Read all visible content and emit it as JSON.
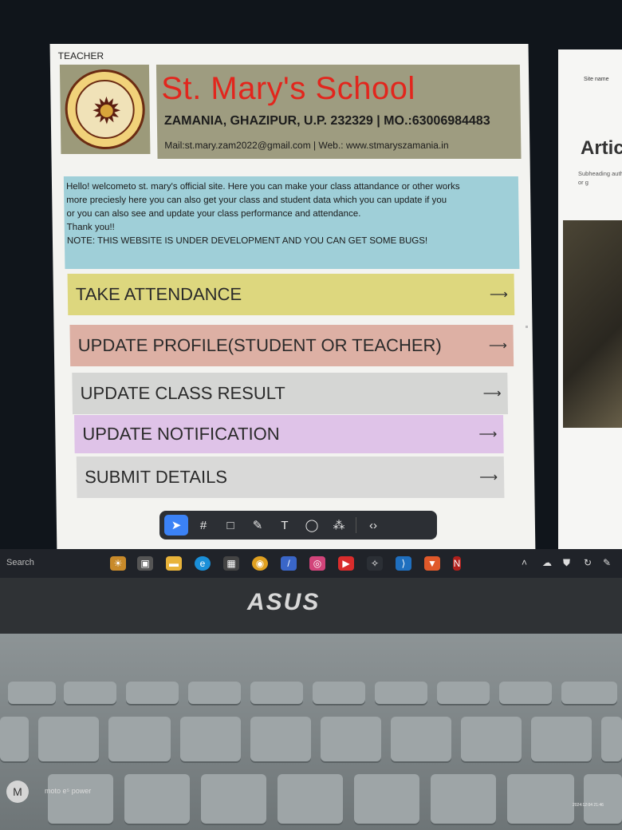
{
  "page": {
    "role_label": "TEACHER",
    "school_name": "St. Mary's School",
    "address": "ZAMANIA, GHAZIPUR, U.P. 232329 | MO.:63006984483",
    "contact": "Mail:st.mary.zam2022@gmail.com | Web.: www.stmaryszamania.in",
    "welcome_lines": [
      "Hello! welcometo st. mary's official site. Here you can make your class attandance or other works",
      "more preciesly here you can also get your class and student data which you can update if you",
      "or you can also see and update your class performance and attendance.",
      "Thank you!!",
      "NOTE: THIS WEBSITE IS UNDER DEVELOPMENT AND YOU CAN GET SOME BUGS!"
    ],
    "menu": [
      {
        "label": "TAKE ATTENDANCE",
        "color": "#ddd77e"
      },
      {
        "label": "UPDATE PROFILE(STUDENT OR TEACHER)",
        "color": "#ddb0a4"
      },
      {
        "label": "UPDATE CLASS RESULT",
        "color": "#d5d6d4"
      },
      {
        "label": "UPDATE NOTIFICATION",
        "color": "#dfc3e8"
      },
      {
        "label": "SUBMIT DETAILS",
        "color": "#d9d9d8"
      }
    ],
    "arrow": "⟶"
  },
  "side_page": {
    "site_name": "Site name",
    "heading": "Artic",
    "subheading": "Subheading author, or g"
  },
  "toolbar": {
    "tools": [
      "pointer-tool-icon",
      "frame-tool-icon",
      "shape-tool-icon",
      "pen-tool-icon",
      "text-tool-icon",
      "comment-tool-icon",
      "components-tool-icon",
      "code-tool-icon"
    ]
  },
  "taskbar": {
    "search_label": "Search"
  },
  "laptop": {
    "brand": "ASUS"
  },
  "camera": {
    "watermark": "moto e⁵ power",
    "timestamp": "2024:12:04 21:46"
  }
}
